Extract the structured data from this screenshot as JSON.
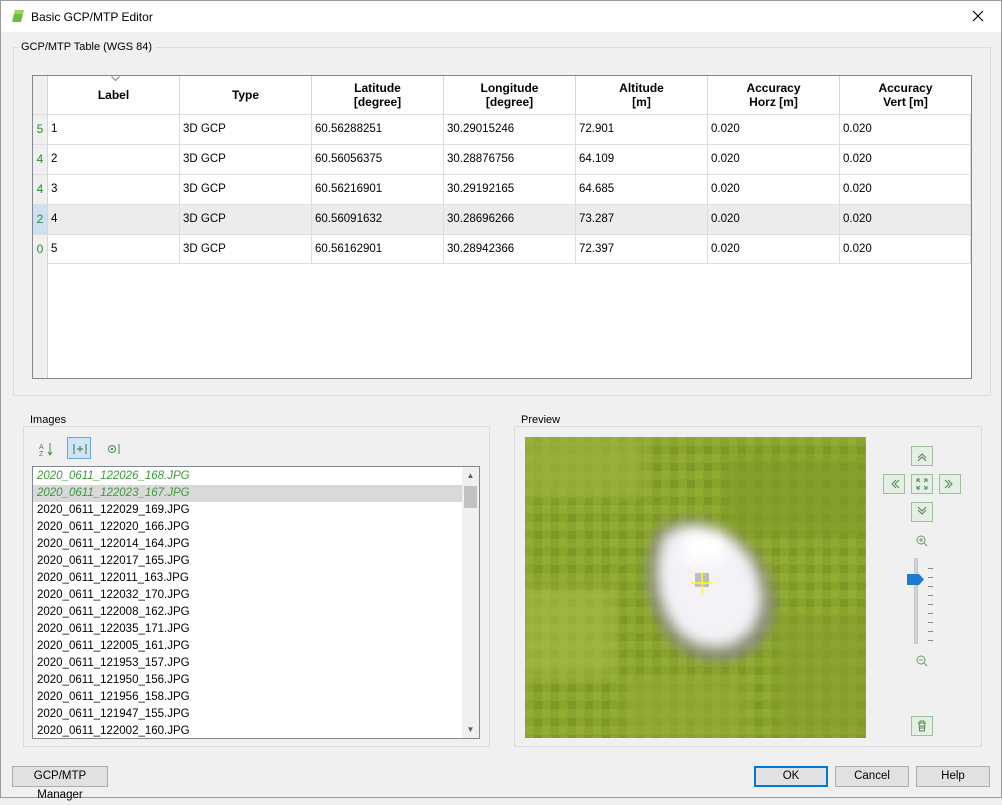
{
  "window": {
    "title": "Basic GCP/MTP Editor"
  },
  "gcp_table": {
    "group_title": "GCP/MTP Table (WGS 84)",
    "columns": [
      {
        "line1": "Label",
        "line2": ""
      },
      {
        "line1": "Type",
        "line2": ""
      },
      {
        "line1": "Latitude",
        "line2": "[degree]"
      },
      {
        "line1": "Longitude",
        "line2": "[degree]"
      },
      {
        "line1": "Altitude",
        "line2": "[m]"
      },
      {
        "line1": "Accuracy",
        "line2": "Horz [m]"
      },
      {
        "line1": "Accuracy",
        "line2": "Vert [m]"
      }
    ],
    "rows": [
      {
        "count": "5",
        "label": "1",
        "type": "3D GCP",
        "lat": "60.56288251",
        "lon": "30.29015246",
        "alt": "72.901",
        "acc_h": "0.020",
        "acc_v": "0.020"
      },
      {
        "count": "4",
        "label": "2",
        "type": "3D GCP",
        "lat": "60.56056375",
        "lon": "30.28876756",
        "alt": "64.109",
        "acc_h": "0.020",
        "acc_v": "0.020"
      },
      {
        "count": "4",
        "label": "3",
        "type": "3D GCP",
        "lat": "60.56216901",
        "lon": "30.29192165",
        "alt": "64.685",
        "acc_h": "0.020",
        "acc_v": "0.020"
      },
      {
        "count": "2",
        "label": "4",
        "type": "3D GCP",
        "lat": "60.56091632",
        "lon": "30.28696266",
        "alt": "73.287",
        "acc_h": "0.020",
        "acc_v": "0.020"
      },
      {
        "count": "0",
        "label": "5",
        "type": "3D GCP",
        "lat": "60.56162901",
        "lon": "30.28942366",
        "alt": "72.397",
        "acc_h": "0.020",
        "acc_v": "0.020"
      }
    ],
    "selected_row": "4"
  },
  "images": {
    "group_title": "Images",
    "toolbar": [
      {
        "icon": "sort-az-icon",
        "active": false
      },
      {
        "icon": "filter-marked-icon",
        "active": true
      },
      {
        "icon": "camera-filter-icon",
        "active": false
      }
    ],
    "items": [
      {
        "name": "2020_0611_122026_168.JPG",
        "used": true,
        "selected": false
      },
      {
        "name": "2020_0611_122023_167.JPG",
        "used": true,
        "selected": true
      },
      {
        "name": "2020_0611_122029_169.JPG",
        "used": false,
        "selected": false
      },
      {
        "name": "2020_0611_122020_166.JPG",
        "used": false,
        "selected": false
      },
      {
        "name": "2020_0611_122014_164.JPG",
        "used": false,
        "selected": false
      },
      {
        "name": "2020_0611_122017_165.JPG",
        "used": false,
        "selected": false
      },
      {
        "name": "2020_0611_122011_163.JPG",
        "used": false,
        "selected": false
      },
      {
        "name": "2020_0611_122032_170.JPG",
        "used": false,
        "selected": false
      },
      {
        "name": "2020_0611_122008_162.JPG",
        "used": false,
        "selected": false
      },
      {
        "name": "2020_0611_122035_171.JPG",
        "used": false,
        "selected": false
      },
      {
        "name": "2020_0611_122005_161.JPG",
        "used": false,
        "selected": false
      },
      {
        "name": "2020_0611_121953_157.JPG",
        "used": false,
        "selected": false
      },
      {
        "name": "2020_0611_121950_156.JPG",
        "used": false,
        "selected": false
      },
      {
        "name": "2020_0611_121956_158.JPG",
        "used": false,
        "selected": false
      },
      {
        "name": "2020_0611_121947_155.JPG",
        "used": false,
        "selected": false
      },
      {
        "name": "2020_0611_122002_160.JPG",
        "used": false,
        "selected": false
      }
    ]
  },
  "preview": {
    "group_title": "Preview",
    "nav_icons": [
      "pan-up-icon",
      "pan-left-icon",
      "fit-view-icon",
      "pan-right-icon",
      "pan-down-icon"
    ],
    "zoom_in_icon": "zoom-in-icon",
    "zoom_out_icon": "zoom-out-icon",
    "zoom_level": 0.8,
    "delete_icon": "delete-marker-icon"
  },
  "footer": {
    "manager_label": "GCP/MTP Manager",
    "ok_label": "OK",
    "cancel_label": "Cancel",
    "help_label": "Help"
  },
  "colors": {
    "used_image_text": "#3a9a3a",
    "row_count_text": "#2e8b2e",
    "marker_cross": "#ffff00",
    "default_button_border": "#0078d7"
  }
}
